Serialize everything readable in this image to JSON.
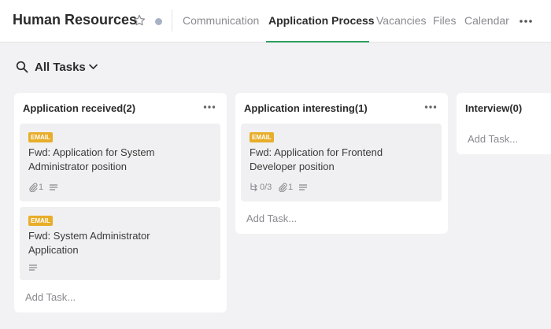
{
  "colors": {
    "accent": "#2e9e5e",
    "badge": "#e8ad2a",
    "status_dot": "#a7b2c4",
    "muted": "#8a8a90"
  },
  "header": {
    "title": "Human Resources",
    "tabs": [
      {
        "label": "Communication"
      },
      {
        "label": "Application Process"
      },
      {
        "label": "Vacancies"
      },
      {
        "label": "Files"
      },
      {
        "label": "Calendar"
      }
    ],
    "active_tab": "Application Process"
  },
  "filter": {
    "label": "All Tasks",
    "icon": "search-icon"
  },
  "columns": [
    {
      "title": "Application received(2)",
      "add_task": "Add Task...",
      "cards": [
        {
          "badge": "EMAIL",
          "title": "Fwd: Application for System Administrator position",
          "attachments": "1",
          "has_description": true
        },
        {
          "badge": "EMAIL",
          "title": "Fwd: System Administrator Application",
          "has_description": true
        }
      ]
    },
    {
      "title": "Application interesting(1)",
      "add_task": "Add Task...",
      "cards": [
        {
          "badge": "EMAIL",
          "title": "Fwd: Application for Frontend Developer position",
          "subtasks": "0/3",
          "attachments": "1",
          "has_description": true
        }
      ]
    },
    {
      "title": "Interview(0)",
      "add_task": "Add Task...",
      "cards": []
    }
  ]
}
